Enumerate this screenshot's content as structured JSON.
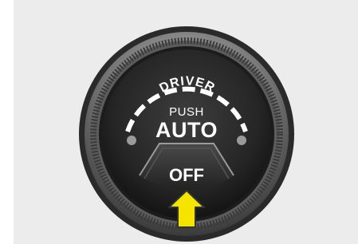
{
  "control": {
    "arc_label": "DRIVER",
    "push_label": "PUSH",
    "auto_label": "AUTO",
    "off_label": "OFF"
  },
  "colors": {
    "panel_background": "#ececec",
    "knob_face": "#2b2b2b",
    "ring": "#8a8a8a",
    "arrow_fill": "#f5e400",
    "arrow_stroke": "#333333",
    "text": "#ffffff"
  },
  "icons": {
    "indicator_arrow": "up-arrow-icon"
  }
}
